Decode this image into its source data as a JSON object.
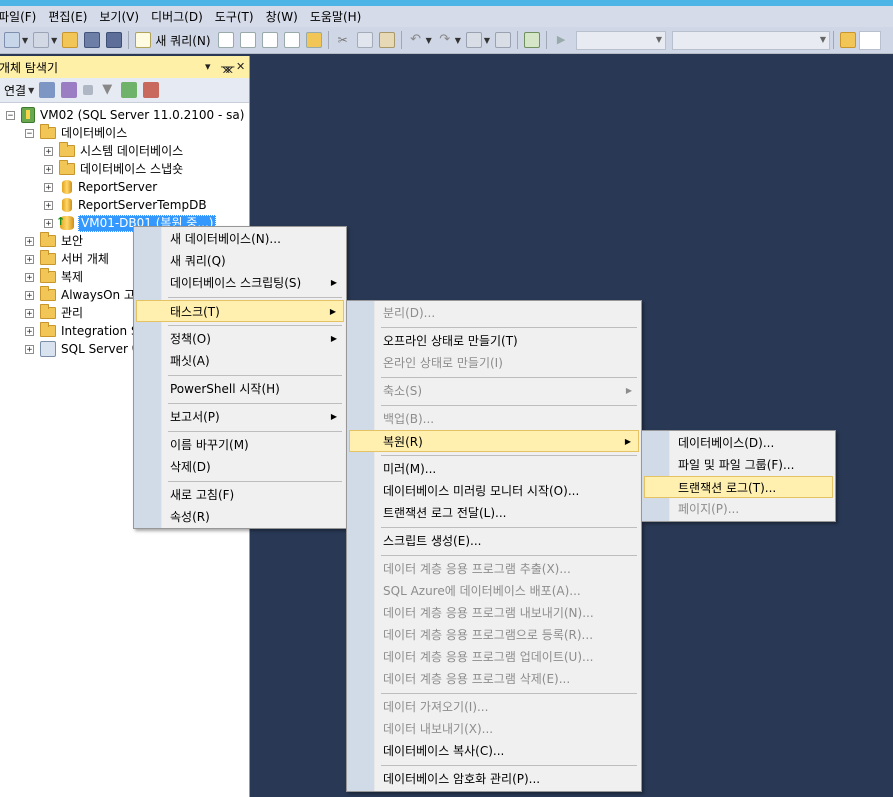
{
  "menubar": [
    "파일(F)",
    "편집(E)",
    "보기(V)",
    "디버그(D)",
    "도구(T)",
    "창(W)",
    "도움말(H)"
  ],
  "toolbar": {
    "new_query": "새 쿼리(N)"
  },
  "object_explorer": {
    "title": "개체 탐색기",
    "header_controls": [
      "▾",
      "ᚘ",
      "✕"
    ],
    "connect": "연결",
    "tree": {
      "server": "VM02 (SQL Server 11.0.2100 - sa)",
      "databases_folder": "데이터베이스",
      "system_dbs": "시스템 데이터베이스",
      "db_snapshots": "데이터베이스 스냅숏",
      "db1": "ReportServer",
      "db2": "ReportServerTempDB",
      "db3": "VM01-DB01 (복원 중...)",
      "security": "보안",
      "server_objects": "서버 개체",
      "replication": "복제",
      "alwayson": "AlwaysOn 고가용성",
      "management": "관리",
      "integration": "Integration Services 카탈로그",
      "agent": "SQL Server 에이전트"
    }
  },
  "context_menu": {
    "new_database": "새 데이터베이스(N)...",
    "new_query": "새 쿼리(Q)",
    "script_database": "데이터베이스 스크립팅(S)",
    "tasks": "태스크(T)",
    "policies": "정책(O)",
    "facets": "패싯(A)",
    "powershell": "PowerShell 시작(H)",
    "reports": "보고서(P)",
    "rename": "이름 바꾸기(M)",
    "delete": "삭제(D)",
    "refresh": "새로 고침(F)",
    "properties": "속성(R)"
  },
  "tasks_menu": {
    "detach": "분리(D)...",
    "take_offline": "오프라인 상태로 만들기(T)",
    "bring_online": "온라인 상태로 만들기(I)",
    "shrink": "축소(S)",
    "backup": "백업(B)...",
    "restore": "복원(R)",
    "mirror": "미러(M)...",
    "launch_mirror_monitor": "데이터베이스 미러링 모니터 시작(O)...",
    "log_shipping": "트랜잭션 로그 전달(L)...",
    "generate_scripts": "스크립트 생성(E)...",
    "extract_dac": "데이터 계층 응용 프로그램 추출(X)...",
    "deploy_azure": "SQL Azure에 데이터베이스 배포(A)...",
    "export_dac": "데이터 계층 응용 프로그램 내보내기(N)...",
    "register_dac": "데이터 계층 응용 프로그램으로 등록(R)...",
    "upgrade_dac": "데이터 계층 응용 프로그램 업데이트(U)...",
    "delete_dac": "데이터 계층 응용 프로그램 삭제(E)...",
    "import_data": "데이터 가져오기(I)...",
    "export_data": "데이터 내보내기(X)...",
    "copy_database": "데이터베이스 복사(C)...",
    "manage_encryption": "데이터베이스 암호화 관리(P)..."
  },
  "restore_menu": {
    "database": "데이터베이스(D)...",
    "files_filegroups": "파일 및 파일 그룹(F)...",
    "transaction_log": "트랜잭션 로그(T)...",
    "page": "페이지(P)..."
  },
  "submenu_arrow": "▶",
  "colors": {
    "editor_bg": "#293955",
    "menu_highlight": "#fff0b0",
    "tree_selection": "#3399ff",
    "panel_header": "#fff0a8"
  }
}
